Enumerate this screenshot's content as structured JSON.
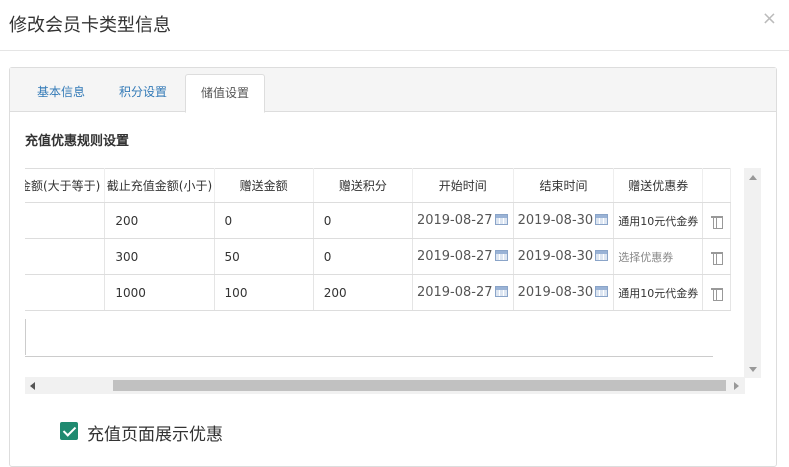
{
  "modal": {
    "title": "修改会员卡类型信息",
    "close_label": "×"
  },
  "tabs": [
    {
      "label": "基本信息",
      "active": false
    },
    {
      "label": "积分设置",
      "active": false
    },
    {
      "label": "储值设置",
      "active": true
    }
  ],
  "section_title": "充值优惠规则设置",
  "table": {
    "headers": [
      "充值金额(大于等于)",
      "截止充值金额(小于)",
      "赠送金额",
      "赠送积分",
      "开始时间",
      "结束时间",
      "赠送优惠券",
      ""
    ],
    "rows": [
      {
        "min": "",
        "max": "200",
        "gift_amount": "0",
        "gift_points": "0",
        "start": "2019-08-27",
        "end": "2019-08-30",
        "coupon": "通用10元代金券",
        "coupon_placeholder": false
      },
      {
        "min": "",
        "max": "300",
        "gift_amount": "50",
        "gift_points": "0",
        "start": "2019-08-27",
        "end": "2019-08-30",
        "coupon": "选择优惠券",
        "coupon_placeholder": true
      },
      {
        "min": "",
        "max": "1000",
        "gift_amount": "100",
        "gift_points": "200",
        "start": "2019-08-27",
        "end": "2019-08-30",
        "coupon": "通用10元代金券",
        "coupon_placeholder": false
      }
    ]
  },
  "icons": {
    "calendar": "calendar-icon",
    "delete": "trash-icon",
    "close": "close-icon"
  },
  "show_offer_checkbox": {
    "label": "充值页面展示优惠",
    "checked": true
  },
  "colors": {
    "tab_link": "#337ab7",
    "checkbox": "#1f8a70"
  }
}
